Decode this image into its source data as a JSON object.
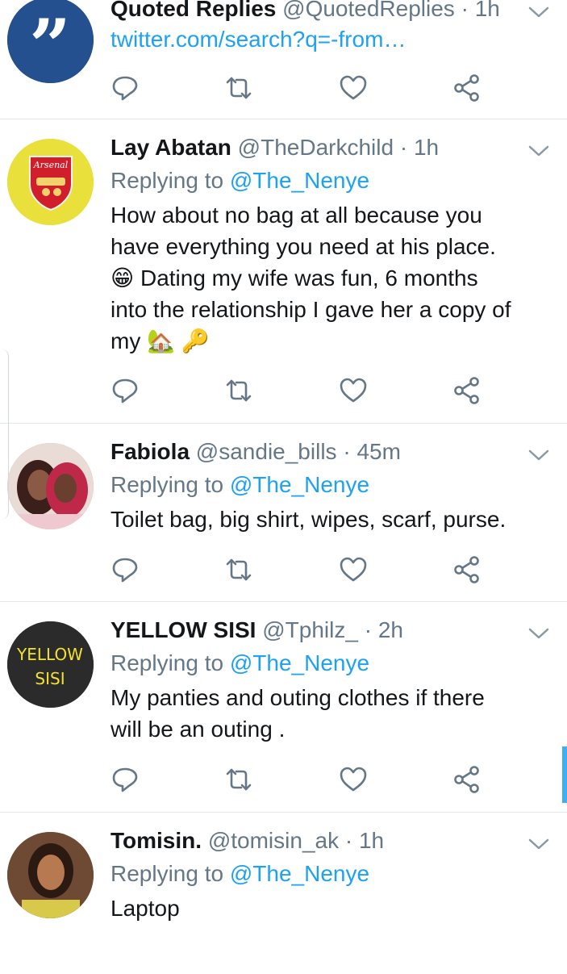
{
  "tweets": [
    {
      "name": "Quoted Replies",
      "handle": "@QuotedReplies",
      "sep": "·",
      "time": "1h",
      "link": "twitter.com/search?q=-from…"
    },
    {
      "name": "Lay Abatan",
      "handle": "@TheDarkchild",
      "sep": "·",
      "time": "1h",
      "replying_prefix": "Replying to",
      "replying_to": "@The_Nenye",
      "text_lines": [
        "How about no bag at all because you",
        "have everything you need at his place.",
        "😁 Dating my wife was fun, 6 months",
        "into the relationship I gave her a copy of",
        "my 🏡 🔑"
      ]
    },
    {
      "name": "Fabiola",
      "handle": "@sandie_bills",
      "sep": "·",
      "time": "45m",
      "replying_prefix": "Replying to",
      "replying_to": "@The_Nenye",
      "text_lines": [
        "Toilet bag, big shirt, wipes, scarf, purse."
      ]
    },
    {
      "name": "YELLOW SISI",
      "handle": "@Tphilz_",
      "sep": "·",
      "time": "2h",
      "avatar_text_1": "YELLOW",
      "avatar_text_2": "SISI",
      "replying_prefix": "Replying to",
      "replying_to": "@The_Nenye",
      "text_lines": [
        "My panties and outing clothes if there",
        "will be an outing ."
      ]
    },
    {
      "name": "Tomisin.",
      "handle": "@tomisin_ak",
      "sep": "·",
      "time": "1h",
      "replying_prefix": "Replying to",
      "replying_to": "@The_Nenye",
      "text_lines": [
        "Laptop"
      ]
    }
  ],
  "avatar_glyphs": {
    "quote": "”",
    "arsenal": "Arsenal"
  },
  "colors": {
    "accent": "#1da1f2",
    "secondary_text": "#657786",
    "primary_text": "#14171a",
    "divider": "#e1e8ed"
  },
  "icons": [
    "reply-icon",
    "retweet-icon",
    "like-icon",
    "share-icon",
    "chevron-down-icon"
  ]
}
